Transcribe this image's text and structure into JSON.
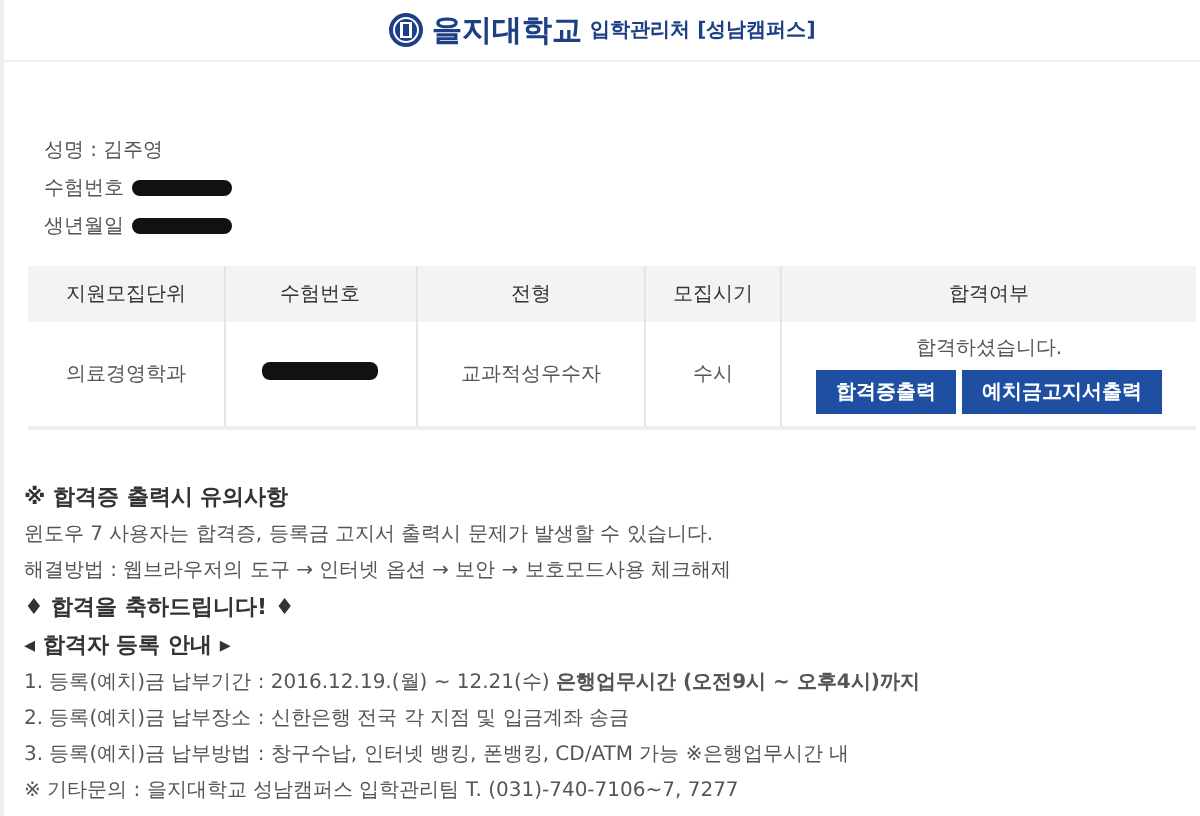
{
  "header": {
    "logo_name": "을지대학교",
    "subtitle": "입학관리처 [성남캠퍼스]"
  },
  "applicant": [
    {
      "label": "성명 : 김주영",
      "redacted": false
    },
    {
      "label": "수험번호",
      "redacted": true
    },
    {
      "label": "생년월일",
      "redacted": true
    }
  ],
  "table": {
    "columns": [
      "지원모집단위",
      "수험번호",
      "전형",
      "모집시기",
      "합격여부"
    ],
    "rows": [
      {
        "cells": [
          {
            "text": "의료경영학과",
            "redacted": false
          },
          {
            "text": "",
            "redacted": true
          },
          {
            "text": "교과적성우수자",
            "redacted": false
          },
          {
            "text": "수시",
            "redacted": false
          }
        ],
        "result": "합격하셨습니다.",
        "buttons": [
          "합격증출력",
          "예치금고지서출력"
        ]
      }
    ]
  },
  "notice": {
    "title": "※ 합격증 출력시 유의사항",
    "lines": [
      "윈도우 7 사용자는 합격증, 등록금 고지서 출력시 문제가 발생할 수 있습니다.",
      "해결방법 : 웹브라우저의 도구 → 인터넷 옵션 → 보안 → 보호모드사용 체크해제"
    ]
  },
  "congrats": "♦ 합격을 축하드립니다! ♦",
  "registration": {
    "title": "◂ 합격자 등록 안내 ▸",
    "lines": [
      "1. 등록(예치)금 납부기간 : 2016.12.19.(월) ~ 12.21(수) **은행업무시간 (오전9시 ~ 오후4시)까지**",
      "2. 등록(예치)금 납부장소 : 신한은행 전국 각 지점 및 입금계좌 송금",
      "3. 등록(예치)금 납부방법 : 창구수납, 인터넷 뱅킹, 폰뱅킹, CD/ATM 가능 ※은행업무시간 내",
      "※ 기타문의 : 을지대학교 성남캠퍼스 입학관리팀 T. (031)-740-7106~7, 7277"
    ]
  }
}
